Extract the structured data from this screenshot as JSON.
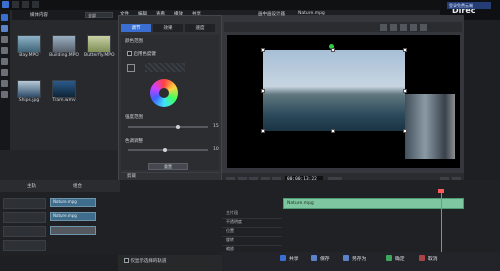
{
  "menubar": [
    "文件",
    "编辑",
    "查看",
    "播放",
    "共享"
  ],
  "brand": {
    "text": "Direc"
  },
  "cloud_badge": "登录免费云端",
  "library": {
    "tab_label": "媒体内容",
    "filter_label": "全部",
    "items": [
      {
        "name": "Bay.MPO"
      },
      {
        "name": "Building.MPO"
      },
      {
        "name": "Butterfly.MPO"
      },
      {
        "name": "Ships.jpg"
      },
      {
        "name": "Tram.wmv"
      }
    ]
  },
  "fx_panel": {
    "tabs": [
      "调节",
      "效果",
      "速度"
    ],
    "checkbox_label": "启用色度键",
    "labels": [
      "颜色范围",
      "强度范围",
      "色调调整"
    ],
    "slider1_value": "15",
    "slider2_value": "10",
    "reset_label": "重置",
    "sections": [
      "剪裁",
      "倒影",
      "边框",
      "翻面",
      "显示比例",
      "3D 设置"
    ],
    "footer_checkbox": "仅显示选择的轨道"
  },
  "preview": {
    "title": "画中画设计器",
    "clip_name": "Nature.mpg",
    "timecode": "00;00;13;22"
  },
  "timeline": {
    "tab_left": "主轨",
    "tab_right": "组合",
    "clip_labels": [
      "Nature.mpg",
      "Nature.mpg"
    ],
    "green_clip": "Nature.mpg",
    "right_rows": [
      "主片段",
      "不透明度",
      "位置",
      "旋转",
      "缩放"
    ]
  },
  "bottom_buttons": {
    "share": "共享",
    "save": "保存",
    "save_as": "另存为",
    "ok": "确定",
    "cancel": "取消"
  }
}
